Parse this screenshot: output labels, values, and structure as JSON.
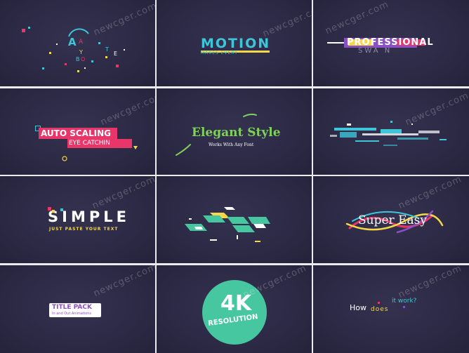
{
  "watermark": "newcger.com",
  "tiles": {
    "t1": {
      "letters": [
        "A",
        "A",
        "Y",
        "T",
        "E",
        "B",
        "O"
      ]
    },
    "t2": {
      "title": "MOTION",
      "sub": "MAKES EVERY"
    },
    "t3": {
      "title": "PROFESSIONAL",
      "sub": "SWA N"
    },
    "t4": {
      "line1": "AUTO SCALING",
      "line2": "EYE CATCHIN"
    },
    "t5": {
      "title": "Elegant Style",
      "sub": "Works With Any Font"
    },
    "t7": {
      "title": "SIMPLE",
      "sub": "JUST PASTE YOUR TEXT"
    },
    "t9": {
      "title": "Super Easy"
    },
    "t10": {
      "title": "TITLE PACK",
      "sub": "In and Out Animations"
    },
    "t11": {
      "big": "4K",
      "sub": "RESOLUTION"
    },
    "t12": {
      "w1": "How",
      "w2": "does",
      "w3": "it work?"
    }
  },
  "colors": {
    "bg": "#2c2a45",
    "cyan": "#3ec6d8",
    "yellow": "#f5d84a",
    "pink": "#e8356a",
    "green": "#7fd15a",
    "teal": "#47c7a0",
    "purple": "#8a4fc1"
  }
}
